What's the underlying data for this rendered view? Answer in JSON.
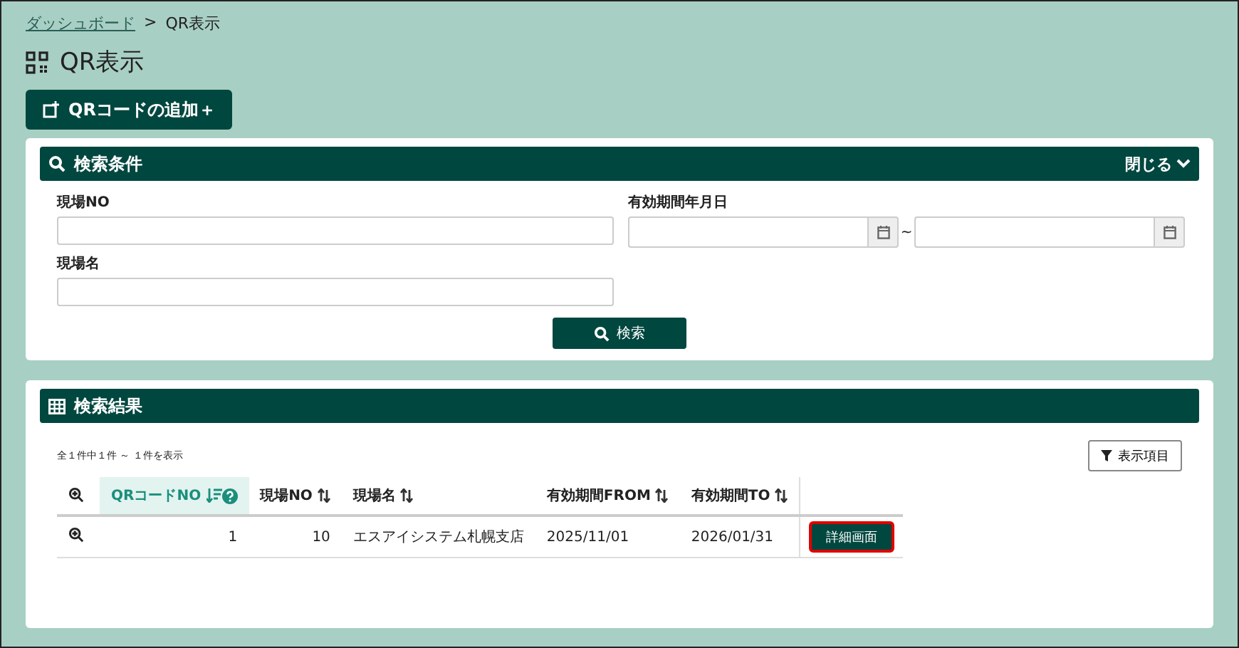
{
  "breadcrumb": [
    {
      "label": "ダッシュボード",
      "link": true
    },
    {
      "label": ">",
      "link": false
    },
    {
      "label": "QR表示",
      "link": false
    }
  ],
  "page_title": "QR表示",
  "add_button": "QRコードの追加＋",
  "search_panel": {
    "title": "検索条件",
    "toggle": "閉じる",
    "fields": [
      {
        "label": "現場NO",
        "kind": "text"
      },
      {
        "label": "有効期間年月日",
        "kind": "daterange",
        "separator": "~"
      },
      {
        "label": "現場名",
        "kind": "text"
      }
    ],
    "search_button": "検索"
  },
  "results_panel": {
    "title": "検索結果",
    "summary": "全１件中１件 ～ １件を表示",
    "columns_button": "表示項目",
    "table": {
      "columns": [
        {
          "label": "QRコードNO",
          "sorted": true,
          "help": true
        },
        {
          "label": "現場NO",
          "sorted": false,
          "help": false
        },
        {
          "label": "現場名",
          "sorted": false,
          "help": false
        },
        {
          "label": "有効期間FROM",
          "sorted": false,
          "help": false
        },
        {
          "label": "有効期間TO",
          "sorted": false,
          "help": false
        }
      ],
      "rows": [
        {
          "cells": [
            "1",
            "10",
            "エスアイシステム札幌支店",
            "2025/11/01",
            "2026/01/31"
          ],
          "action": "詳細画面",
          "highlighted": true
        }
      ]
    }
  }
}
